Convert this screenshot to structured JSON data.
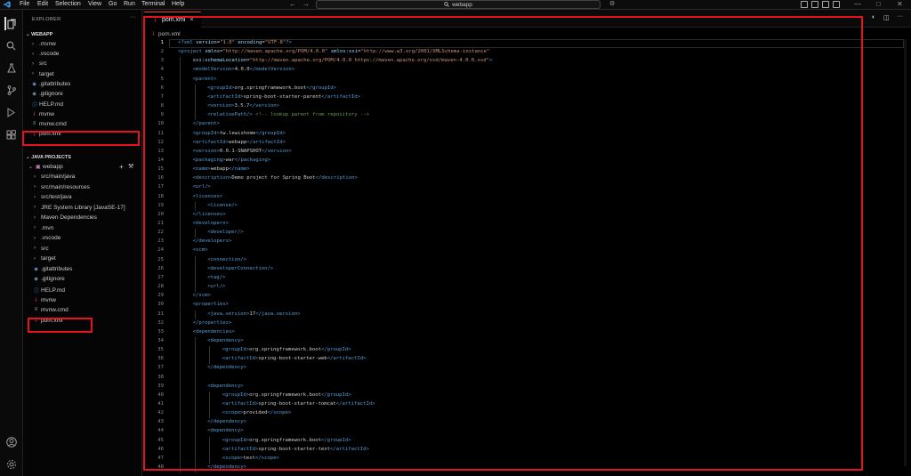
{
  "menu": [
    "File",
    "Edit",
    "Selection",
    "View",
    "Go",
    "Run",
    "Terminal",
    "Help"
  ],
  "search": "webapp",
  "explorer": {
    "title": "EXPLORER",
    "section": "WEBAPP",
    "items": [
      {
        "label": ".mvnw",
        "type": "dir"
      },
      {
        "label": ".vscode",
        "type": "dir"
      },
      {
        "label": "src",
        "type": "dir"
      },
      {
        "label": "target",
        "type": "dir"
      },
      {
        "label": ".gitattributes",
        "type": "git"
      },
      {
        "label": ".gitignore",
        "type": "git"
      },
      {
        "label": "HELP.md",
        "type": "md"
      },
      {
        "label": "mvnw",
        "type": "xml"
      },
      {
        "label": "mvnw.cmd",
        "type": "plain"
      },
      {
        "label": "pom.xml",
        "type": "xml"
      }
    ]
  },
  "java": {
    "section": "JAVA PROJECTS",
    "root": "webapp",
    "items": [
      {
        "label": "src/main/java",
        "type": "dir"
      },
      {
        "label": "src/main/resources",
        "type": "dir"
      },
      {
        "label": "src/test/java",
        "type": "dir"
      },
      {
        "label": "JRE System Library [JavaSE-17]",
        "type": "dir"
      },
      {
        "label": "Maven Dependencies",
        "type": "dir"
      },
      {
        "label": ".mvn",
        "type": "dir"
      },
      {
        "label": ".vscode",
        "type": "dir"
      },
      {
        "label": "src",
        "type": "dir"
      },
      {
        "label": "target",
        "type": "dir"
      },
      {
        "label": ".gitattributes",
        "type": "git"
      },
      {
        "label": ".gitignore",
        "type": "git"
      },
      {
        "label": "HELP.md",
        "type": "md"
      },
      {
        "label": "mvnw",
        "type": "xml"
      },
      {
        "label": "mvnw.cmd",
        "type": "plain"
      },
      {
        "label": "pom.xml",
        "type": "xml"
      }
    ]
  },
  "tab": {
    "label": "pom.xml",
    "close": "×"
  },
  "breadcrumb": "pom.xml",
  "colors": {
    "tag": "#569cd6",
    "attr": "#9cdcfe",
    "string": "#ce9178",
    "comment": "#6a9955",
    "highlight": "#e3131f"
  },
  "lines": [
    {
      "n": "1",
      "bars": 0,
      "t": [
        [
          "<?xml ",
          "tag"
        ],
        [
          "version",
          "attr"
        ],
        [
          "=",
          ""
        ],
        [
          "\"1.0\"",
          "string"
        ],
        [
          " ",
          ""
        ],
        [
          "encoding",
          "attr"
        ],
        [
          "=",
          ""
        ],
        [
          "\"UTF-8\"",
          "string"
        ],
        [
          "?>",
          "tag"
        ]
      ]
    },
    {
      "n": "2",
      "bars": 0,
      "t": [
        [
          "<project ",
          "tag"
        ],
        [
          "xmlns",
          "attr"
        ],
        [
          "=",
          ""
        ],
        [
          "\"http://maven.apache.org/POM/4.0.0\"",
          "string"
        ],
        [
          " ",
          ""
        ],
        [
          "xmlns:xsi",
          "attr"
        ],
        [
          "=",
          ""
        ],
        [
          "\"http://www.w3.org/2001/XMLSchema-instance\"",
          "string"
        ]
      ]
    },
    {
      "n": "3",
      "bars": 1,
      "t": [
        [
          "xsi:schemaLocation",
          "attr"
        ],
        [
          "=",
          ""
        ],
        [
          "\"http://maven.apache.org/POM/4.0.0 https://maven.apache.org/xsd/maven-4.0.0.xsd\"",
          "string"
        ],
        [
          ">",
          "tag"
        ]
      ]
    },
    {
      "n": "4",
      "bars": 1,
      "t": [
        [
          "<modelVersion>",
          "tag"
        ],
        [
          "4.0.0",
          ""
        ],
        [
          "</modelVersion>",
          "tag"
        ]
      ]
    },
    {
      "n": "5",
      "bars": 1,
      "t": [
        [
          "<parent>",
          "tag"
        ]
      ]
    },
    {
      "n": "6",
      "bars": 2,
      "t": [
        [
          "<groupId>",
          "tag"
        ],
        [
          "org.springframework.boot",
          ""
        ],
        [
          "</groupId>",
          "tag"
        ]
      ]
    },
    {
      "n": "7",
      "bars": 2,
      "t": [
        [
          "<artifactId>",
          "tag"
        ],
        [
          "spring-boot-starter-parent",
          ""
        ],
        [
          "</artifactId>",
          "tag"
        ]
      ]
    },
    {
      "n": "8",
      "bars": 2,
      "t": [
        [
          "<version>",
          "tag"
        ],
        [
          "3.5.7",
          ""
        ],
        [
          "</version>",
          "tag"
        ]
      ]
    },
    {
      "n": "9",
      "bars": 2,
      "t": [
        [
          "<relativePath/>",
          "tag"
        ],
        [
          " ",
          ""
        ],
        [
          "<!-- lookup parent from repository -->",
          "comment"
        ]
      ]
    },
    {
      "n": "10",
      "bars": 1,
      "t": [
        [
          "</parent>",
          "tag"
        ]
      ]
    },
    {
      "n": "11",
      "bars": 1,
      "t": [
        [
          "<groupId>",
          "tag"
        ],
        [
          "tw.lewishome",
          ""
        ],
        [
          "</groupId>",
          "tag"
        ]
      ]
    },
    {
      "n": "12",
      "bars": 1,
      "t": [
        [
          "<artifactId>",
          "tag"
        ],
        [
          "webapp",
          ""
        ],
        [
          "</artifactId>",
          "tag"
        ]
      ]
    },
    {
      "n": "13",
      "bars": 1,
      "t": [
        [
          "<version>",
          "tag"
        ],
        [
          "0.0.1-SNAPSHOT",
          ""
        ],
        [
          "</version>",
          "tag"
        ]
      ]
    },
    {
      "n": "14",
      "bars": 1,
      "t": [
        [
          "<packaging>",
          "tag"
        ],
        [
          "war",
          ""
        ],
        [
          "</packaging>",
          "tag"
        ]
      ]
    },
    {
      "n": "15",
      "bars": 1,
      "t": [
        [
          "<name>",
          "tag"
        ],
        [
          "webapp",
          ""
        ],
        [
          "</name>",
          "tag"
        ]
      ]
    },
    {
      "n": "16",
      "bars": 1,
      "t": [
        [
          "<description>",
          "tag"
        ],
        [
          "Demo project for Spring Boot",
          ""
        ],
        [
          "</description>",
          "tag"
        ]
      ]
    },
    {
      "n": "17",
      "bars": 1,
      "t": [
        [
          "<url/>",
          "tag"
        ]
      ]
    },
    {
      "n": "18",
      "bars": 1,
      "t": [
        [
          "<licenses>",
          "tag"
        ]
      ]
    },
    {
      "n": "19",
      "bars": 2,
      "t": [
        [
          "<license/>",
          "tag"
        ]
      ]
    },
    {
      "n": "20",
      "bars": 1,
      "t": [
        [
          "</licenses>",
          "tag"
        ]
      ]
    },
    {
      "n": "21",
      "bars": 1,
      "t": [
        [
          "<developers>",
          "tag"
        ]
      ]
    },
    {
      "n": "22",
      "bars": 2,
      "t": [
        [
          "<developer/>",
          "tag"
        ]
      ]
    },
    {
      "n": "23",
      "bars": 1,
      "t": [
        [
          "</developers>",
          "tag"
        ]
      ]
    },
    {
      "n": "24",
      "bars": 1,
      "t": [
        [
          "<scm>",
          "tag"
        ]
      ]
    },
    {
      "n": "25",
      "bars": 2,
      "t": [
        [
          "<connection/>",
          "tag"
        ]
      ]
    },
    {
      "n": "26",
      "bars": 2,
      "t": [
        [
          "<developerConnection/>",
          "tag"
        ]
      ]
    },
    {
      "n": "27",
      "bars": 2,
      "t": [
        [
          "<tag/>",
          "tag"
        ]
      ]
    },
    {
      "n": "28",
      "bars": 2,
      "t": [
        [
          "<url/>",
          "tag"
        ]
      ]
    },
    {
      "n": "29",
      "bars": 1,
      "t": [
        [
          "</scm>",
          "tag"
        ]
      ]
    },
    {
      "n": "30",
      "bars": 1,
      "t": [
        [
          "<properties>",
          "tag"
        ]
      ]
    },
    {
      "n": "31",
      "bars": 2,
      "t": [
        [
          "<java.version>",
          "tag"
        ],
        [
          "17",
          ""
        ],
        [
          "</java.version>",
          "tag"
        ]
      ]
    },
    {
      "n": "32",
      "bars": 1,
      "t": [
        [
          "</properties>",
          "tag"
        ]
      ]
    },
    {
      "n": "33",
      "bars": 1,
      "t": [
        [
          "<dependencies>",
          "tag"
        ]
      ]
    },
    {
      "n": "34",
      "bars": 2,
      "t": [
        [
          "<dependency>",
          "tag"
        ]
      ]
    },
    {
      "n": "35",
      "bars": 3,
      "t": [
        [
          "<groupId>",
          "tag"
        ],
        [
          "org.springframework.boot",
          ""
        ],
        [
          "</groupId>",
          "tag"
        ]
      ]
    },
    {
      "n": "36",
      "bars": 3,
      "t": [
        [
          "<artifactId>",
          "tag"
        ],
        [
          "spring-boot-starter-web",
          ""
        ],
        [
          "</artifactId>",
          "tag"
        ]
      ]
    },
    {
      "n": "37",
      "bars": 2,
      "t": [
        [
          "</dependency>",
          "tag"
        ]
      ]
    },
    {
      "n": "38",
      "bars": 2,
      "t": []
    },
    {
      "n": "39",
      "bars": 2,
      "t": [
        [
          "<dependency>",
          "tag"
        ]
      ]
    },
    {
      "n": "40",
      "bars": 3,
      "t": [
        [
          "<groupId>",
          "tag"
        ],
        [
          "org.springframework.boot",
          ""
        ],
        [
          "</groupId>",
          "tag"
        ]
      ]
    },
    {
      "n": "41",
      "bars": 3,
      "t": [
        [
          "<artifactId>",
          "tag"
        ],
        [
          "spring-boot-starter-tomcat",
          ""
        ],
        [
          "</artifactId>",
          "tag"
        ]
      ]
    },
    {
      "n": "42",
      "bars": 3,
      "t": [
        [
          "<scope>",
          "tag"
        ],
        [
          "provided",
          ""
        ],
        [
          "</scope>",
          "tag"
        ]
      ]
    },
    {
      "n": "43",
      "bars": 2,
      "t": [
        [
          "</dependency>",
          "tag"
        ]
      ]
    },
    {
      "n": "44",
      "bars": 2,
      "t": [
        [
          "<dependency>",
          "tag"
        ]
      ]
    },
    {
      "n": "45",
      "bars": 3,
      "t": [
        [
          "<groupId>",
          "tag"
        ],
        [
          "org.springframework.boot",
          ""
        ],
        [
          "</groupId>",
          "tag"
        ]
      ]
    },
    {
      "n": "46",
      "bars": 3,
      "t": [
        [
          "<artifactId>",
          "tag"
        ],
        [
          "spring-boot-starter-test",
          ""
        ],
        [
          "</artifactId>",
          "tag"
        ]
      ]
    },
    {
      "n": "47",
      "bars": 3,
      "t": [
        [
          "<scope>",
          "tag"
        ],
        [
          "test",
          ""
        ],
        [
          "</scope>",
          "tag"
        ]
      ]
    },
    {
      "n": "48",
      "bars": 2,
      "t": [
        [
          "</dependency>",
          "tag"
        ]
      ]
    }
  ]
}
